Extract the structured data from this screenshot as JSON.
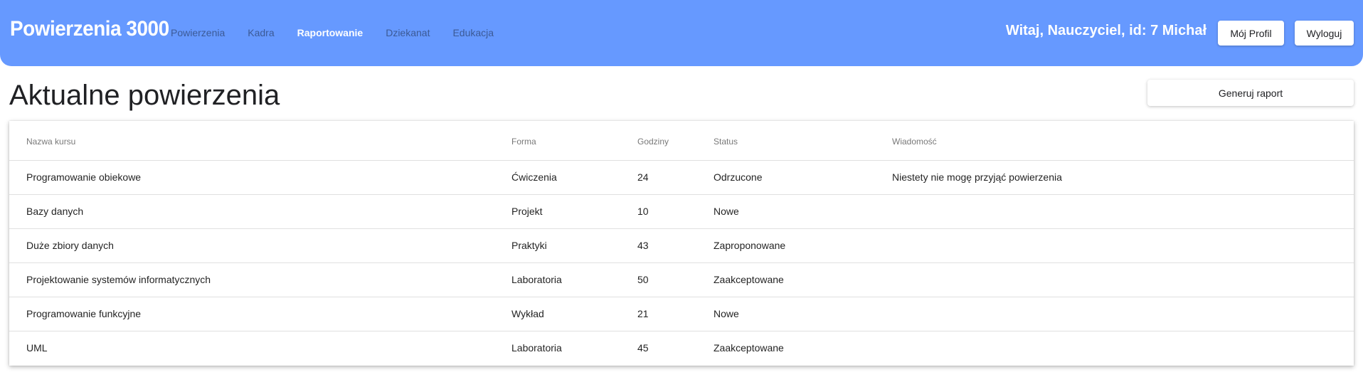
{
  "header": {
    "brand": "Powierzenia 3000",
    "nav": [
      "Powierzenia",
      "Kadra",
      "Raportowanie",
      "Dziekanat",
      "Edukacja"
    ],
    "active_nav": "Raportowanie",
    "greeting": "Witaj, Nauczyciel, id: 7 Michał",
    "profile_button": "Mój Profil",
    "logout_button": "Wyloguj"
  },
  "main": {
    "title": "Aktualne powierzenia",
    "report_button": "Generuj raport",
    "table": {
      "columns": [
        "Nazwa kursu",
        "Forma",
        "Godziny",
        "Status",
        "Wiadomość"
      ],
      "rows": [
        [
          "Programowanie obiekowe",
          "Ćwiczenia",
          "24",
          "Odrzucone",
          "Niestety nie mogę przyjąć powierzenia"
        ],
        [
          "Bazy danych",
          "Projekt",
          "10",
          "Nowe",
          ""
        ],
        [
          "Duże zbiory danych",
          "Praktyki",
          "43",
          "Zaproponowane",
          ""
        ],
        [
          "Projektowanie systemów informatycznych",
          "Laboratoria",
          "50",
          "Zaakceptowane",
          ""
        ],
        [
          "Programowanie funkcyjne",
          "Wykład",
          "21",
          "Nowe",
          ""
        ],
        [
          "UML",
          "Laboratoria",
          "45",
          "Zaakceptowane",
          ""
        ]
      ]
    }
  },
  "colors": {
    "navbar": "#6699ff",
    "nav_inactive": "rgba(0,0,0,0.42)",
    "nav_active": "#ffffff"
  }
}
